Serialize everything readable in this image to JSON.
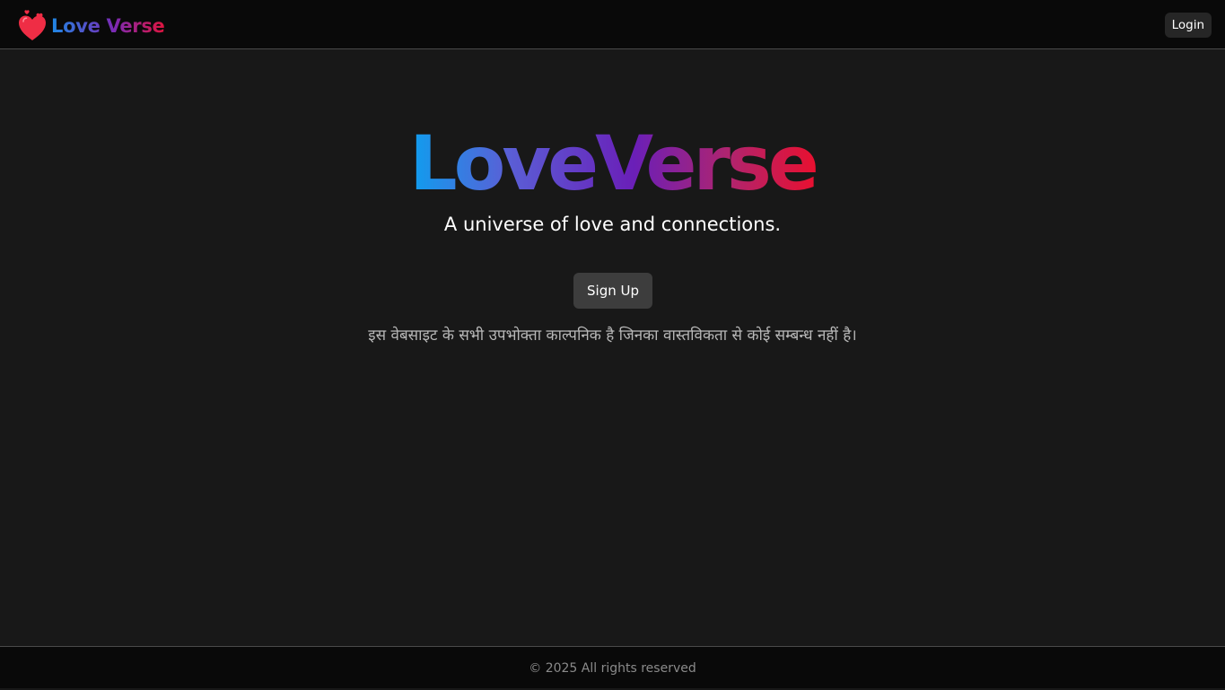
{
  "header": {
    "brand_text": "Love Verse",
    "brand_icon": "hearts-icon",
    "login_label": "Login"
  },
  "hero": {
    "title": "LoveVerse",
    "tagline": "A universe of love and connections.",
    "signup_label": "Sign Up",
    "disclaimer": "इस वेबसाइट के सभी उपभोक्ता काल्पनिक है जिनका वास्तविकता से कोई सम्बन्ध नहीं है।"
  },
  "footer": {
    "copyright": "© 2025 All rights reserved"
  },
  "colors": {
    "background": "#181818",
    "header_footer_bg": "#090909",
    "gradient_start": "#0aa2f0",
    "gradient_mid": "#6a1fb8",
    "gradient_end": "#ec0f2c",
    "heart_red": "#ef2d45"
  }
}
